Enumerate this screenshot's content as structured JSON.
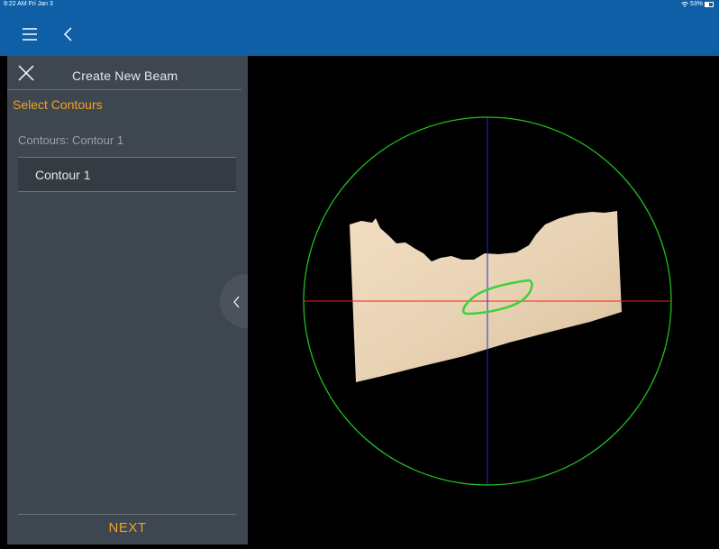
{
  "status": {
    "time": "9:22 AM  Fri Jan 3",
    "battery": "53%"
  },
  "sidebar": {
    "title": "Create New Beam",
    "step_label": "Select Contours",
    "contours_label": "Contours: Contour 1",
    "contours": [
      {
        "label": "Contour 1"
      }
    ],
    "next_label": "NEXT"
  },
  "viewer": {
    "circle_color": "#1fbf1f",
    "horizontal_axis_color": "#ff1a1a",
    "vertical_axis_color": "#2a2ad6",
    "surface_color": "#e9d3b5",
    "contour_color": "#3cd23c"
  },
  "icons": {
    "menu": "hamburger-menu-icon",
    "back": "chevron-left-icon",
    "close": "close-icon",
    "collapse": "chevron-left-icon",
    "wifi": "wifi-icon",
    "battery": "battery-icon"
  }
}
